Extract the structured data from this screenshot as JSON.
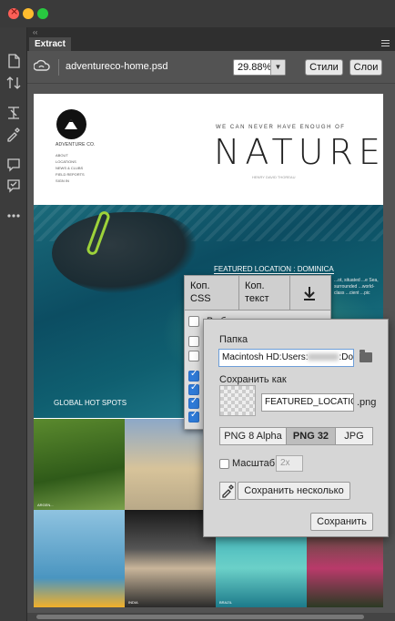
{
  "window": {
    "panel_tab": "Extract",
    "collapse_glyph": "‹‹"
  },
  "header": {
    "filename": "adventureco-home.psd",
    "zoom": "29.88%",
    "styles_button": "Стили",
    "layers_button": "Слои"
  },
  "site": {
    "logo_text": "ADVENTURE CO.",
    "nav": [
      "ABOUT",
      "LOCATIONS",
      "NEWS & CLUBS",
      "FIELD REPORTS",
      "SIGN IN"
    ],
    "tagline": "WE CAN NEVER HAVE ENOUGH OF",
    "headline": "NATURE",
    "quote_author": "HENRY DAVID THOREAU",
    "featured": "FEATURED LOCATION : DOMINICA",
    "hero_side": "...ot, situated ...e Sea, surrounded ...world-class ...cient ...pic",
    "gallery_title": "GLOBAL HOT SPOTS",
    "gallery_labels": [
      "ARGEN...",
      "INDIA",
      "BRAZIL"
    ]
  },
  "css_menu": {
    "col1": "Коп. CSS",
    "col2": "Коп. текст",
    "row_label": "Выбрать все"
  },
  "export_panel": {
    "folder_label": "Папка",
    "folder_value_prefix": "Macintosh HD:Users:",
    "folder_value_suffix": ":Docu",
    "save_as_label": "Сохранить как",
    "filename_value": "FEATURED_LOCATION",
    "extension": ".png",
    "formats": [
      "PNG 8 Alpha",
      "PNG 32",
      "JPG"
    ],
    "active_format": "PNG 32",
    "scale_label": "Масштаб",
    "scale_value": "2x",
    "save_multiple_button": "Сохранить несколько",
    "save_button": "Сохранить"
  }
}
